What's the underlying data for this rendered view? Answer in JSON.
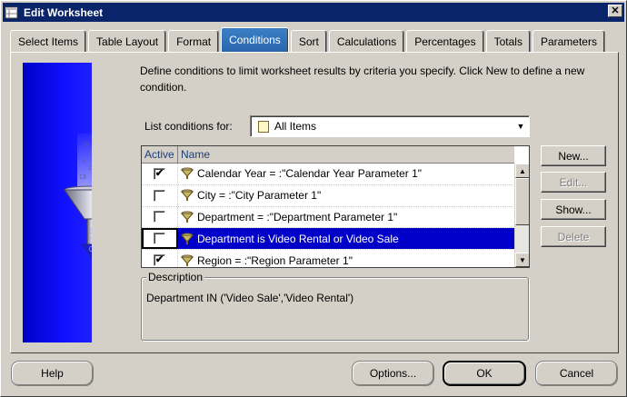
{
  "window": {
    "title": "Edit Worksheet",
    "close_glyph": "✕"
  },
  "tabs": [
    {
      "label": "Select Items",
      "active": false
    },
    {
      "label": "Table Layout",
      "active": false
    },
    {
      "label": "Format",
      "active": false
    },
    {
      "label": "Conditions",
      "active": true
    },
    {
      "label": "Sort",
      "active": false
    },
    {
      "label": "Calculations",
      "active": false
    },
    {
      "label": "Percentages",
      "active": false
    },
    {
      "label": "Totals",
      "active": false
    },
    {
      "label": "Parameters",
      "active": false
    }
  ],
  "intro": "Define conditions to limit worksheet results by criteria you specify. Click New to define a new condition.",
  "list_for": {
    "label": "List conditions for:",
    "value": "All Items"
  },
  "grid": {
    "columns": [
      "Active",
      "Name"
    ],
    "rows": [
      {
        "active": true,
        "check": "✔",
        "name": "Calendar Year = :\"Calendar Year Parameter 1\"",
        "selected": false
      },
      {
        "active": false,
        "check": "",
        "name": "City = :\"City Parameter 1\"",
        "selected": false
      },
      {
        "active": false,
        "check": "",
        "name": "Department = :\"Department Parameter 1\"",
        "selected": false
      },
      {
        "active": false,
        "check": "",
        "name": "Department is Video Rental or Video Sale",
        "selected": true
      },
      {
        "active": true,
        "check": "✔",
        "name": "Region = :\"Region Parameter 1\"",
        "selected": false
      }
    ]
  },
  "side_buttons": {
    "new": "New...",
    "edit": "Edit...",
    "show": "Show...",
    "delete": "Delete"
  },
  "description": {
    "legend": "Description",
    "text": "Department IN ('Video Sale','Video Rental')"
  },
  "bottom_buttons": {
    "help": "Help",
    "options": "Options...",
    "ok": "OK",
    "cancel": "Cancel"
  },
  "funnel_digits": [
    "6",
    "%",
    "4",
    "2",
    "13",
    "5",
    "3",
    "0"
  ],
  "colors": {
    "title_bar": "#0a246a",
    "selection": "#0000c8",
    "funnel_panel": "#1010ff",
    "active_tab": "#2a66ad"
  }
}
